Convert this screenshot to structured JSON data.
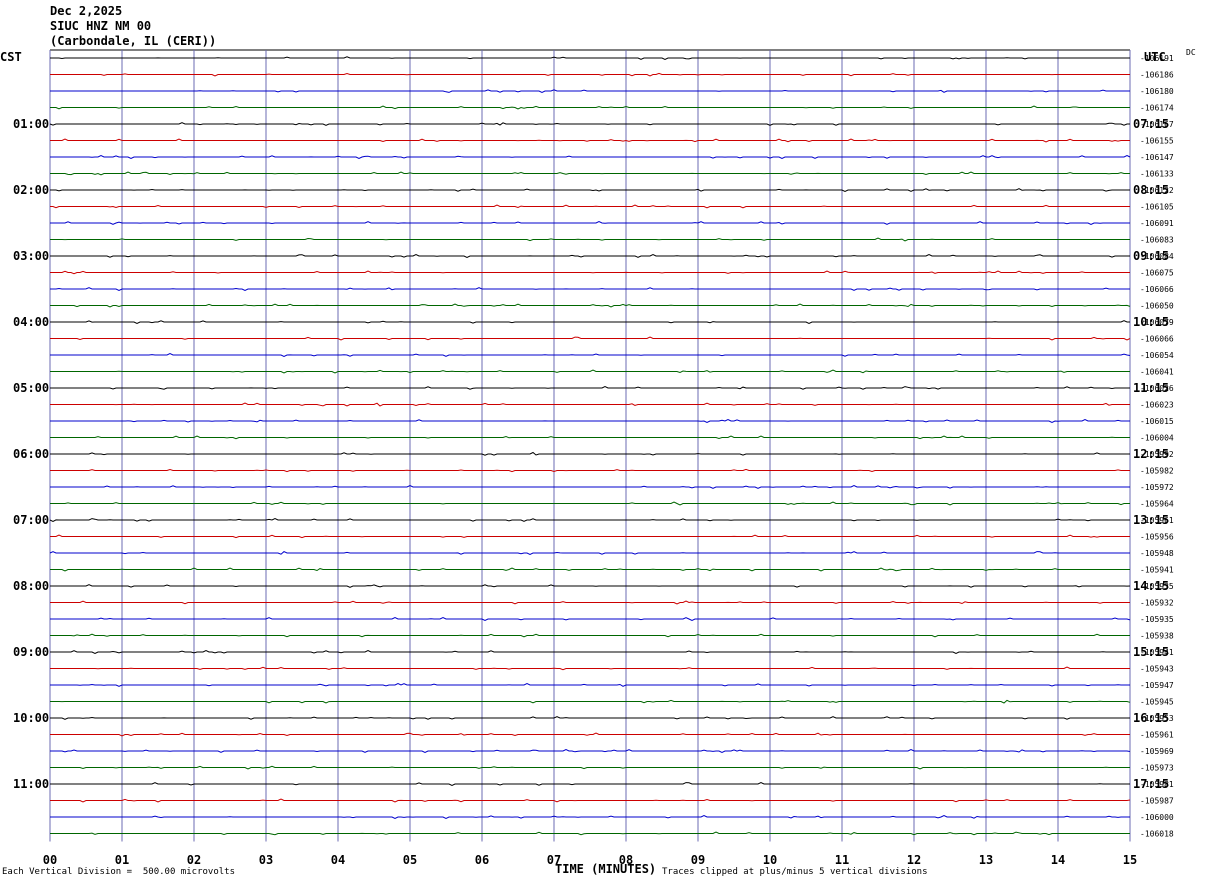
{
  "header": {
    "date": "Dec 2,2025",
    "station": "SIUC HNZ NM 00",
    "location": "(Carbondale, IL (CERI))"
  },
  "left_tz": "CST",
  "right_tz": "UTC",
  "dc_label": "DC",
  "footer": {
    "scale_note": "Each Vertical Division =  500.00 microvolts",
    "xlabel": "TIME (MINUTES)",
    "clip_note": "Traces clipped at plus/minus 5 vertical divisions"
  },
  "colors": {
    "trace_cycle": [
      "#000000",
      "#cc0000",
      "#0000cc",
      "#006600"
    ],
    "grid": "#808080",
    "vgrid": "#6b6bb3"
  },
  "chart_data": {
    "type": "line",
    "title": "",
    "xlabel": "TIME (MINUTES)",
    "ylabel": "",
    "xlim": [
      0,
      15
    ],
    "x_ticks": [
      "00",
      "01",
      "02",
      "03",
      "04",
      "05",
      "06",
      "07",
      "08",
      "09",
      "10",
      "11",
      "12",
      "13",
      "14",
      "15"
    ],
    "left_hour_labels": [
      "01:00",
      "02:00",
      "03:00",
      "04:00",
      "05:00",
      "06:00",
      "07:00",
      "08:00",
      "09:00",
      "10:00",
      "11:00"
    ],
    "right_hour_labels": [
      "07:15",
      "08:15",
      "09:15",
      "10:15",
      "11:15",
      "12:15",
      "13:15",
      "14:15",
      "15:15",
      "16:15",
      "17:15"
    ],
    "trace_offsets": [
      "-106191",
      "-106186",
      "-106180",
      "-106174",
      "-106167",
      "-106155",
      "-106147",
      "-106133",
      "-106122",
      "-106105",
      "-106091",
      "-106083",
      "-106084",
      "-106075",
      "-106066",
      "-106050",
      "-106079",
      "-106066",
      "-106054",
      "-106041",
      "-106026",
      "-106023",
      "-106015",
      "-106004",
      "-105992",
      "-105982",
      "-105972",
      "-105964",
      "-105961",
      "-105956",
      "-105948",
      "-105941",
      "-105935",
      "-105932",
      "-105935",
      "-105938",
      "-105941",
      "-105943",
      "-105947",
      "-105945",
      "-105953",
      "-105961",
      "-105969",
      "-105973",
      "-105981",
      "-105987",
      "-106000",
      "-106018"
    ],
    "trace_count": 48,
    "minutes_per_trace": 15,
    "microvolts_per_division": 500,
    "clip_divisions": 5
  }
}
